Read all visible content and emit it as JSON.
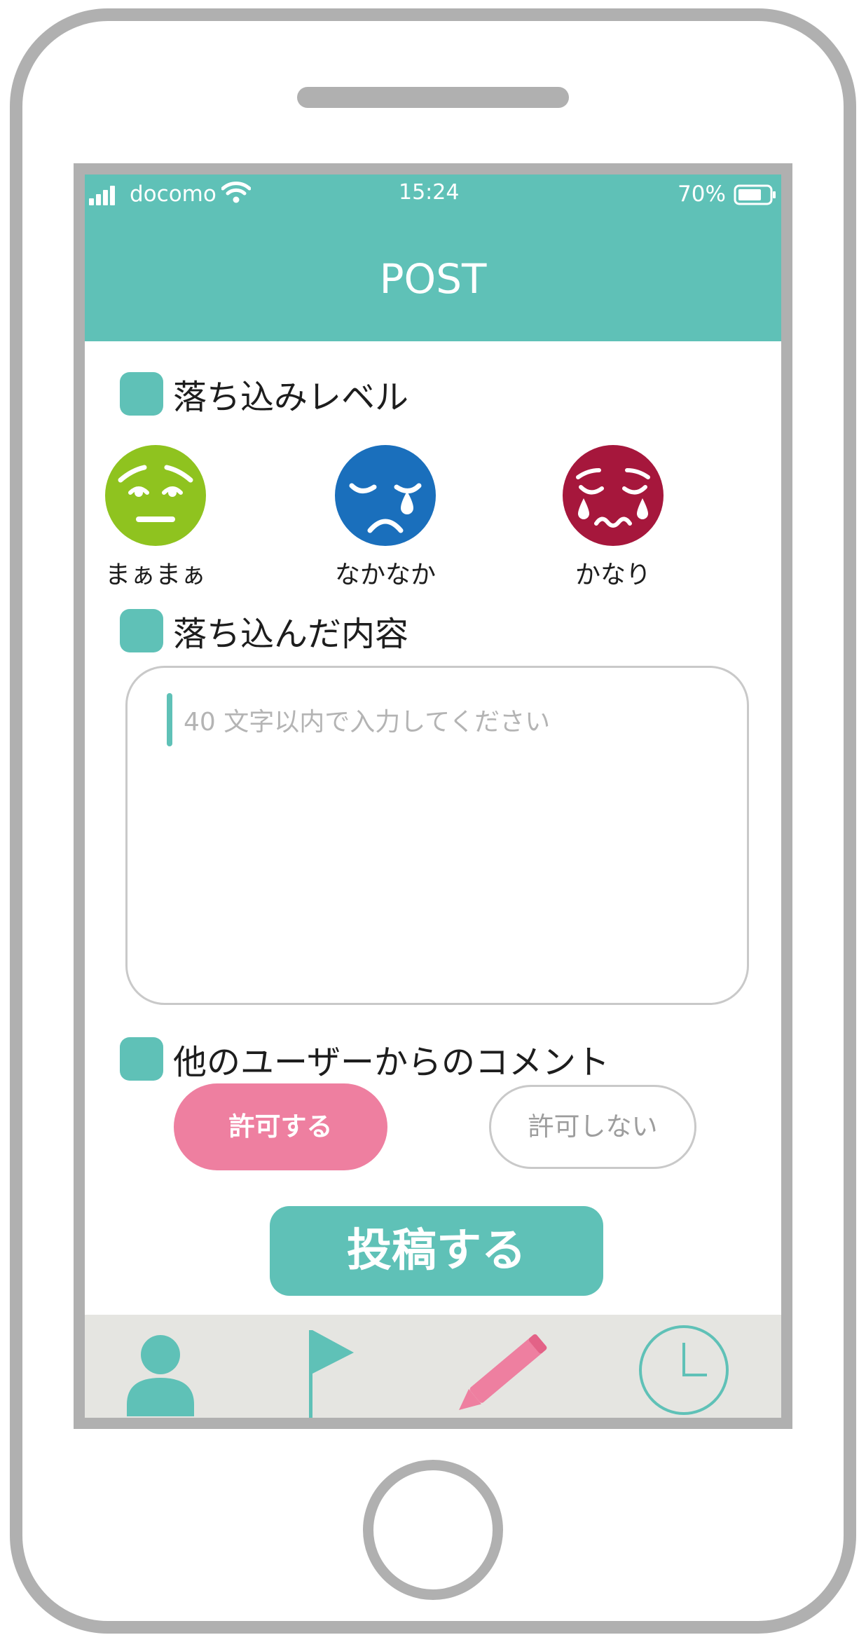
{
  "status_bar": {
    "carrier": "docomo",
    "time": "15:24",
    "battery": "70%"
  },
  "header": {
    "title": "POST"
  },
  "sections": {
    "level": "落ち込みレベル",
    "content": "落ち込んだ内容",
    "comments": "他のユーザーからのコメント"
  },
  "moods": [
    {
      "label": "まぁまぁ",
      "color": "#8fc31f"
    },
    {
      "label": "なかなか",
      "color": "#1a6fbc"
    },
    {
      "label": "かなり",
      "color": "#a6173c"
    }
  ],
  "textarea": {
    "placeholder": "40 文字以内で入力してください"
  },
  "comment_options": {
    "allow": "許可する",
    "deny": "許可しない"
  },
  "submit": {
    "label": "投稿する"
  },
  "tabs": [
    {
      "icon": "user-icon"
    },
    {
      "icon": "flag-icon"
    },
    {
      "icon": "pencil-icon"
    },
    {
      "icon": "clock-icon"
    }
  ],
  "colors": {
    "accent": "#5fc1b7",
    "pink": "#ee7fa0",
    "frame": "#b0b0b0"
  }
}
